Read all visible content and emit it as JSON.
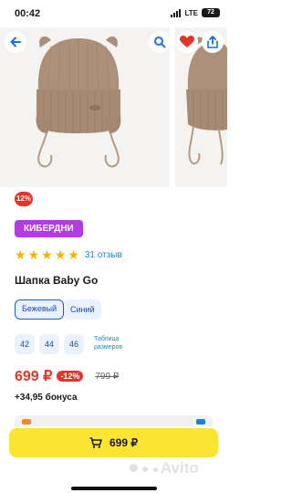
{
  "status_bar": {
    "time": "00:42",
    "network": "LTE",
    "battery": "72"
  },
  "gallery": {
    "photo_desc": "beige knitted baby hat with ear flaps and ties"
  },
  "product": {
    "discount_badge": "12%",
    "promo_badge": "КИБЕРДНИ",
    "rating_stars": 5,
    "reviews": "31 отзыв",
    "title": "Шапка Baby Go",
    "colors": [
      {
        "label": "Бежевый",
        "selected": true
      },
      {
        "label": "Синий",
        "selected": false
      }
    ],
    "sizes": [
      "42",
      "44",
      "46"
    ],
    "size_table": "Таблица размеров",
    "price": "699 ₽",
    "price_discount": "-12%",
    "old_price": "799 ₽",
    "bonus": "+34,95 бонуса"
  },
  "buy_button": {
    "label": "699 ₽"
  },
  "watermark": {
    "text": "Avito"
  },
  "colors": {
    "accent_red": "#e6342a",
    "promo_purple": "#b13ce3",
    "button_yellow": "#fce433",
    "link_blue": "#0a8de0",
    "star_gold": "#f5b400"
  }
}
